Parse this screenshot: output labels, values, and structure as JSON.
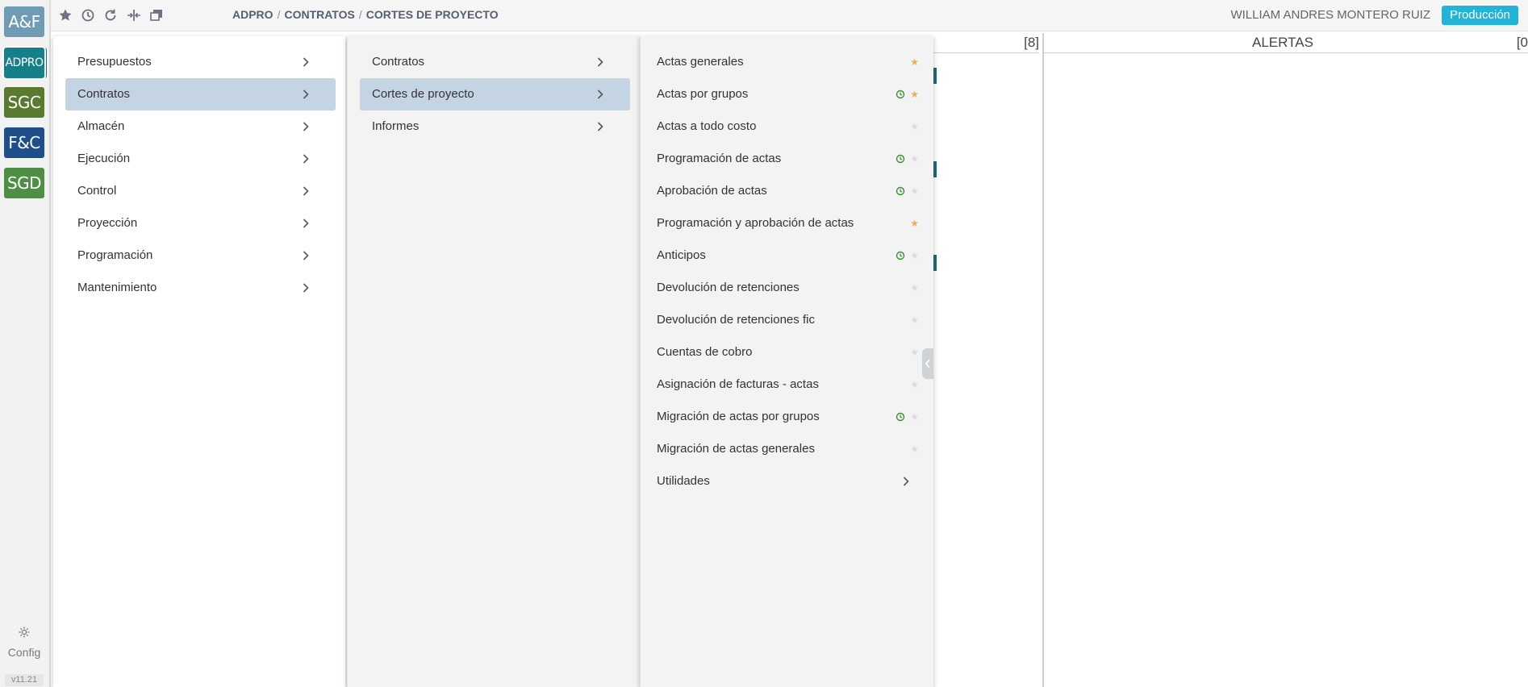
{
  "rail": {
    "modules": [
      {
        "label": "A&F",
        "color": "#6f9bb5"
      },
      {
        "label": "ADPRO",
        "color": "#16808a"
      },
      {
        "label": "SGC",
        "color": "#5a7a2f"
      },
      {
        "label": "F&C",
        "color": "#1e4f8a"
      },
      {
        "label": "SGD",
        "color": "#4f8f45"
      }
    ],
    "config_label": "Config",
    "version": "v11.21"
  },
  "topbar": {
    "icons": [
      "star-icon",
      "history-icon",
      "refresh-icon",
      "split-icon",
      "windows-icon"
    ],
    "breadcrumb": [
      "ADPRO",
      "CONTRATOS",
      "CORTES DE PROYECTO"
    ],
    "user_name": "WILLIAM ANDRES MONTERO RUIZ",
    "environment": "Producción"
  },
  "background": {
    "count_left": "[8]",
    "alerts_title": "ALERTAS",
    "count_right": "[0"
  },
  "menu": {
    "level1": [
      {
        "label": "Presupuestos",
        "selected": false
      },
      {
        "label": "Contratos",
        "selected": true
      },
      {
        "label": "Almacén",
        "selected": false
      },
      {
        "label": "Ejecución",
        "selected": false
      },
      {
        "label": "Control",
        "selected": false
      },
      {
        "label": "Proyección",
        "selected": false
      },
      {
        "label": "Programación",
        "selected": false
      },
      {
        "label": "Mantenimiento",
        "selected": false
      }
    ],
    "level2": [
      {
        "label": "Contratos",
        "selected": false
      },
      {
        "label": "Cortes de proyecto",
        "selected": true
      },
      {
        "label": "Informes",
        "selected": false
      }
    ],
    "level3": [
      {
        "label": "Actas generales",
        "favorite": true,
        "recent": false
      },
      {
        "label": "Actas por grupos",
        "favorite": true,
        "recent": true
      },
      {
        "label": "Actas a todo costo",
        "favorite": false,
        "recent": false
      },
      {
        "label": "Programación de actas",
        "favorite": false,
        "recent": true
      },
      {
        "label": "Aprobación de actas",
        "favorite": false,
        "recent": true
      },
      {
        "label": "Programación y aprobación de actas",
        "favorite": true,
        "recent": false
      },
      {
        "label": "Anticipos",
        "favorite": false,
        "recent": true
      },
      {
        "label": "Devolución de retenciones",
        "favorite": false,
        "recent": false
      },
      {
        "label": "Devolución de retenciones fic",
        "favorite": false,
        "recent": false
      },
      {
        "label": "Cuentas de cobro",
        "favorite": false,
        "recent": false
      },
      {
        "label": "Asignación de facturas - actas",
        "favorite": false,
        "recent": false
      },
      {
        "label": "Migración de actas por grupos",
        "favorite": false,
        "recent": true
      },
      {
        "label": "Migración de actas generales",
        "favorite": false,
        "recent": false
      },
      {
        "label": "Utilidades",
        "submenu": true
      }
    ]
  },
  "colors": {
    "selected_bg": "#c4d4e3",
    "favorite_star": "#f0ad4e",
    "recent_clock": "#3c8f3c",
    "environment_badge": "#21b4d8"
  }
}
